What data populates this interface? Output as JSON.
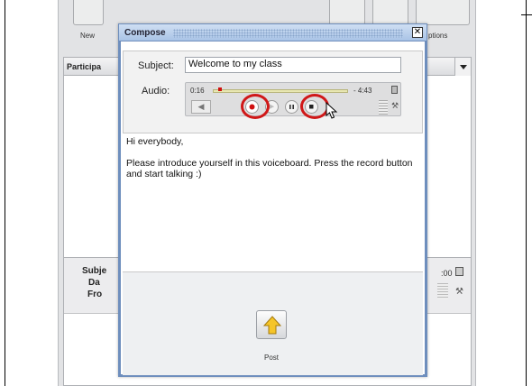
{
  "toolbar": {
    "new_label": "New",
    "options_label": "ptions"
  },
  "participants": {
    "title": "Participa"
  },
  "details": {
    "subject_label": "Subje",
    "date_label": "Da",
    "from_label": "Fro",
    "time": ":00"
  },
  "compose": {
    "title": "Compose",
    "subject_label": "Subject:",
    "subject_value": "Welcome to my class",
    "audio_label": "Audio:",
    "player": {
      "elapsed": "0:16",
      "duration": "- 4:43",
      "progress_fraction": 0.04
    },
    "body": [
      "Hi everybody,",
      "Please introduce yourself in this voiceboard. Press the record button and start talking :)"
    ],
    "post_label": "Post"
  },
  "icons": [
    "close-icon",
    "record-icon",
    "pause-icon",
    "stop-icon",
    "volume-icon",
    "trash-icon",
    "tools-icon",
    "arrow-up-icon",
    "cursor-icon"
  ],
  "colors": {
    "accent": "#6e8ebd",
    "annotation_red": "#d01818",
    "record_red": "#d01010"
  }
}
